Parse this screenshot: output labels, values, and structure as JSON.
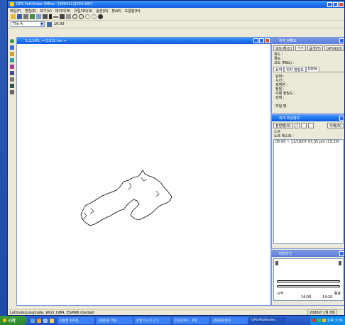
{
  "window": {
    "title": "GPS Pathfinder Office - [0804111[034.SSF]"
  },
  "menu": [
    "파일(F)",
    "편집(E)",
    "보기(V)",
    "데이터(D)",
    "유틸리티(U)",
    "옵션(O)",
    "창(W)",
    "도움말(H)"
  ],
  "toolbar": {
    "layer_select": "Tile A",
    "zoom_field": "10:00"
  },
  "map": {
    "title_text": "1:2,545, ↔ 0.612 km ↔"
  },
  "pos_panel": {
    "title": "위치 정확도",
    "buttons": [
      "보트/해(O)",
      "<<",
      "옵셋(T)",
      "GPS로(D)"
    ],
    "fields": [
      "위도 :",
      "경도 :",
      "고도 (MSL) :"
    ],
    "tabs": [
      "요약",
      "위치 정밀도",
      "DOPs"
    ],
    "details": [
      "날짜 :",
      "시간 :",
      "측정한 :",
      "정밀 :",
      "수평 정밀도 :",
      "상태 :",
      "",
      "파일 명 :"
    ]
  },
  "feature_panel": {
    "title": "피쳐 특성정보",
    "buttons": [
      "정방향(O)",
      "|",
      "",
      "",
      "삭제(D)"
    ],
    "header": "노트",
    "sub_header": "노트 텍스트 :",
    "row": "05:00 ~ 11/16/07 03:35 pm (15:20)"
  },
  "time_panel": {
    "title": "타임라인",
    "axis_left": "시작",
    "tick1": "14:00",
    "tick2": "14:20",
    "axis_right": "종료"
  },
  "statusbar": {
    "coords": "Latitude/Longitude, WGS 1984, EGM96 (Global)",
    "date": "2008년 1월 8일"
  },
  "taskbar": {
    "start": "시작",
    "tasks": [
      "산림청 위치정...",
      "산림청회 측량...",
      "분할 다스크 (C:)",
      "한글2007 - 한글",
      "산림대관청보...",
      "GPS Pathfinder..."
    ],
    "clock": "오후 3:36"
  },
  "colors": {
    "titlebar": "#0a5ae0",
    "taskbar": "#1f4fc0",
    "start": "#2d862d"
  }
}
